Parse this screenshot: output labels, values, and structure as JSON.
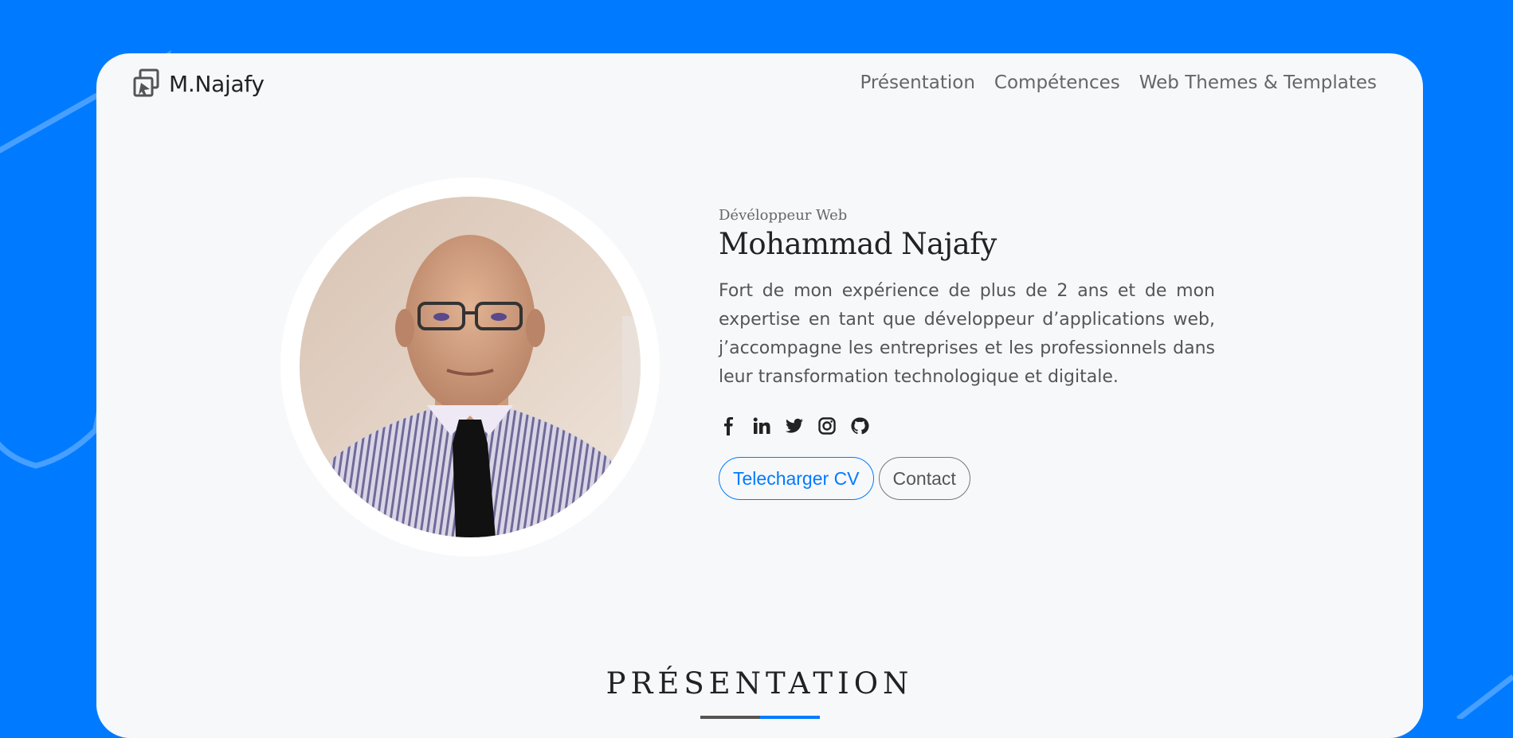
{
  "brand": {
    "logo_text": "M.Najafy",
    "logo_icon": "stacked-squares-logo-icon"
  },
  "nav": {
    "items": [
      {
        "label": "Présentation"
      },
      {
        "label": "Compétences"
      },
      {
        "label": "Web Themes & Templates"
      }
    ]
  },
  "hero": {
    "role": "Dévéloppeur Web",
    "name": "Mohammad Najafy",
    "bio": "Fort de mon expérience de plus de 2 ans et de mon expertise en tant que développeur d’applications web, j’accompagne les entreprises et les professionnels dans leur transformation technologique et digitale.",
    "social": [
      {
        "icon": "facebook-icon"
      },
      {
        "icon": "linkedin-icon"
      },
      {
        "icon": "twitter-icon"
      },
      {
        "icon": "instagram-icon"
      },
      {
        "icon": "github-icon"
      }
    ],
    "buttons": {
      "cv_label": "Telecharger CV",
      "contact_label": "Contact"
    }
  },
  "section": {
    "title": "PRÉSENTATION"
  },
  "colors": {
    "background": "#007bff",
    "card": "#f7f8fa",
    "accent": "#007bff",
    "text": "#222222",
    "muted": "#666666"
  }
}
